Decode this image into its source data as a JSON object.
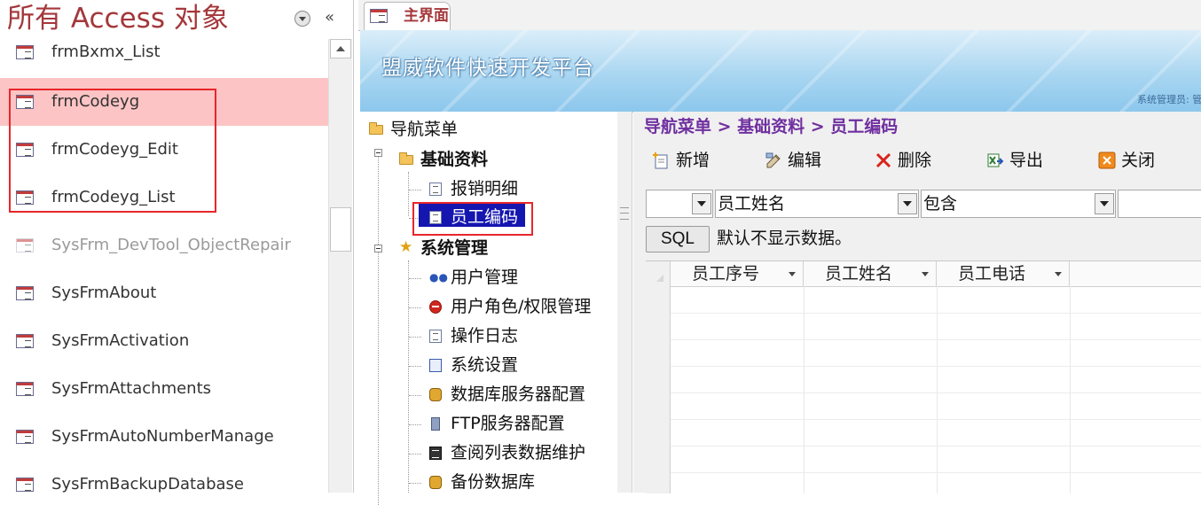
{
  "nav_pane": {
    "title": "所有 Access 对象",
    "collapse_glyph": "«",
    "items": [
      {
        "label": "frmBxmx_List",
        "selected": false,
        "faded": false
      },
      {
        "label": "frmCodeyg",
        "selected": true,
        "faded": false
      },
      {
        "label": "frmCodeyg_Edit",
        "selected": false,
        "faded": false
      },
      {
        "label": "frmCodeyg_List",
        "selected": false,
        "faded": false
      },
      {
        "label": "SysFrm_DevTool_ObjectRepair",
        "selected": false,
        "faded": true
      },
      {
        "label": "SysFrmAbout",
        "selected": false,
        "faded": false
      },
      {
        "label": "SysFrmActivation",
        "selected": false,
        "faded": false
      },
      {
        "label": "SysFrmAttachments",
        "selected": false,
        "faded": false
      },
      {
        "label": "SysFrmAutoNumberManage",
        "selected": false,
        "faded": false
      },
      {
        "label": "SysFrmBackupDatabase",
        "selected": false,
        "faded": false
      }
    ],
    "selected_color": "#fcc4c4",
    "highlight_color": "#e8262b"
  },
  "document": {
    "tab_label": "主界面",
    "banner_title": "盟威软件快速开发平台",
    "banner_user": "系统管理员: 管",
    "tree": {
      "root": "导航菜单",
      "groups": [
        {
          "label": "基础资料",
          "icon": "folder-icon",
          "items": [
            {
              "label": "报销明细",
              "icon": "doc-icon"
            },
            {
              "label": "员工编码",
              "icon": "doc-icon",
              "selected": true
            }
          ]
        },
        {
          "label": "系统管理",
          "icon": "star-icon",
          "items": [
            {
              "label": "用户管理",
              "icon": "users-icon"
            },
            {
              "label": "用户角色/权限管理",
              "icon": "red-circle-icon"
            },
            {
              "label": "操作日志",
              "icon": "doc-icon"
            },
            {
              "label": "系统设置",
              "icon": "settings-icon"
            },
            {
              "label": "数据库服务器配置",
              "icon": "database-icon"
            },
            {
              "label": "FTP服务器配置",
              "icon": "server-icon"
            },
            {
              "label": "查阅列表数据维护",
              "icon": "table-icon"
            },
            {
              "label": "备份数据库",
              "icon": "database-icon"
            }
          ]
        }
      ]
    },
    "content": {
      "breadcrumb": "导航菜单 > 基础资料 > 员工编码",
      "toolbar": {
        "new_label": "新增",
        "edit_label": "编辑",
        "delete_label": "删除",
        "export_label": "导出",
        "close_label": "关闭"
      },
      "filter": {
        "field_1_value": "",
        "field_name_value": "员工姓名",
        "operator_value": "包含",
        "search_value": ""
      },
      "sql_button_label": "SQL",
      "sql_message": "默认不显示数据。",
      "grid": {
        "columns": [
          "员工序号",
          "员工姓名",
          "员工电话"
        ]
      }
    },
    "accent_color": "#7030a0",
    "selection_color": "#1515b0"
  }
}
